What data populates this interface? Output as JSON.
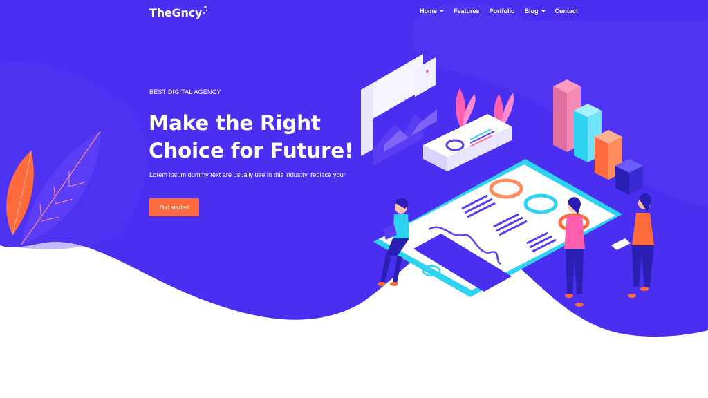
{
  "brand": {
    "logo_text": "TheGncy"
  },
  "nav": {
    "items": [
      {
        "label": "Home",
        "has_dropdown": true
      },
      {
        "label": "Features",
        "has_dropdown": false
      },
      {
        "label": "Portfolio",
        "has_dropdown": false
      },
      {
        "label": "Blog",
        "has_dropdown": true
      },
      {
        "label": "Contact",
        "has_dropdown": false
      }
    ]
  },
  "hero": {
    "eyebrow": "BEST DIGITAL AGENCY",
    "headline_line1": "Make the Right",
    "headline_line2": "Choice for Future!",
    "subtext": "Lorem ipsum dummy text are usually use in this industry. replace your",
    "cta_label": "Get started"
  },
  "colors": {
    "hero_bg": "#4a2ff0",
    "accent": "#ff6b3d",
    "text": "#ffffff"
  },
  "icons": [
    "caret-down-icon",
    "logo-dots-icon",
    "leaf-illustration",
    "dashboard-illustration"
  ]
}
